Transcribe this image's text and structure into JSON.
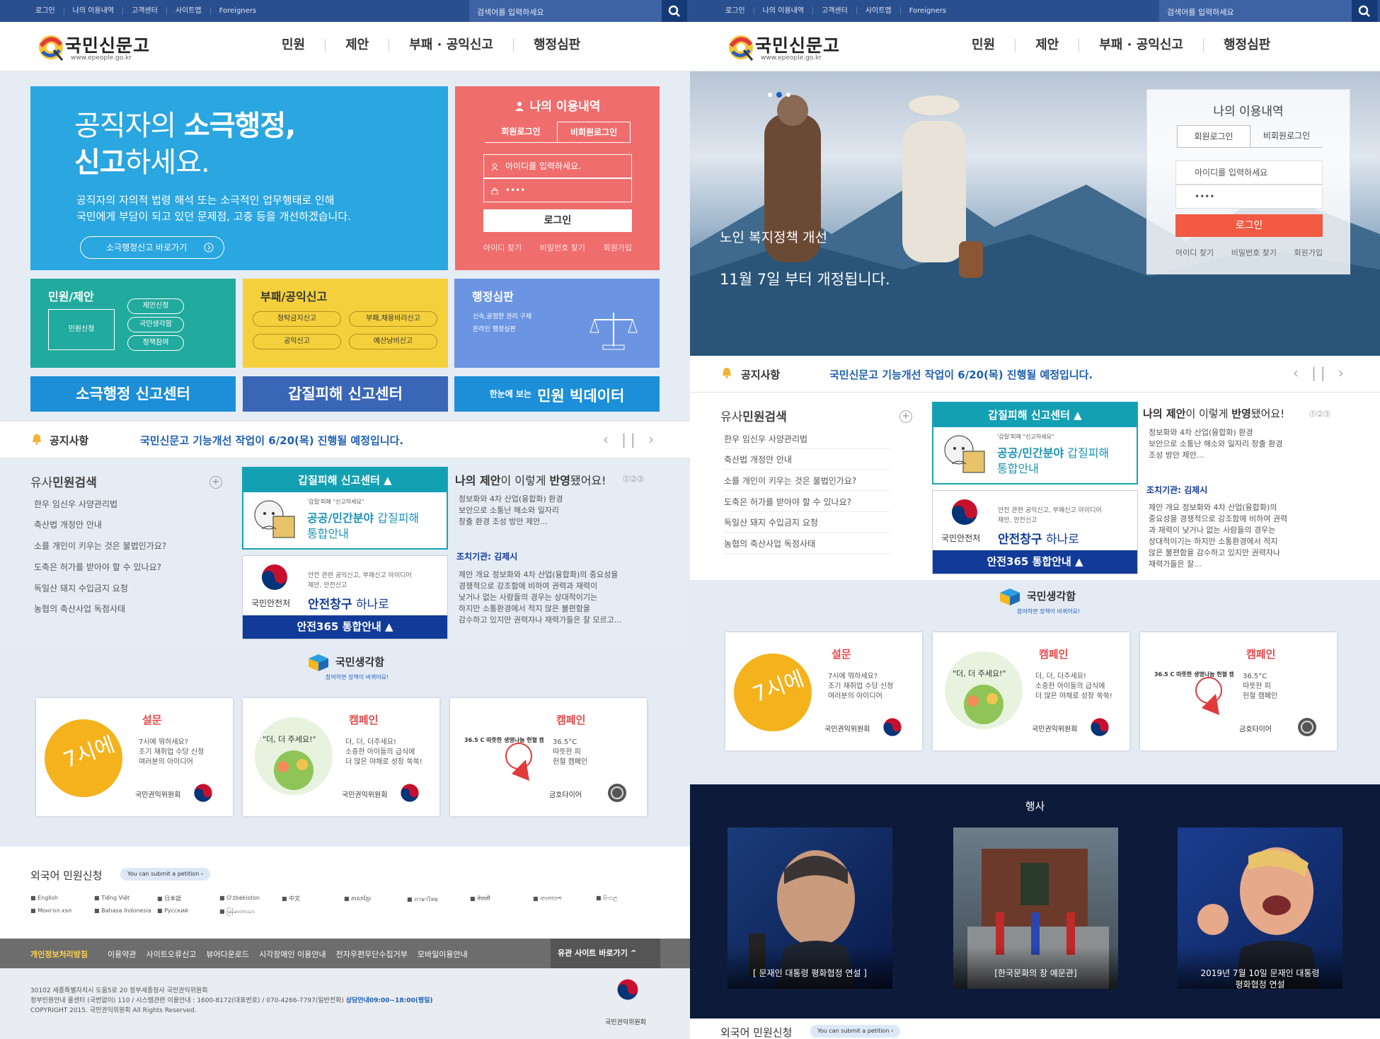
{
  "topbar": {
    "links": [
      "로그인",
      "나의 이용내역",
      "고객센터",
      "사이트맵",
      "Foreigners"
    ],
    "search_placeholder": "검색어를 입력하세요"
  },
  "logo": {
    "title": "국민신문고",
    "url": "www.epeople.go.kr"
  },
  "nav": [
    "민원",
    "제안",
    "부패 · 공익신고",
    "행정심판"
  ],
  "heroA": {
    "title_a": "공직자의 ",
    "title_b": "소극행정,",
    "title_c": "신고",
    "title_d": "하세요.",
    "desc_1": "공직자의 자의적 법령 해석 또는 소극적인 업무행태로 인해",
    "desc_2": "국민에게 부담이 되고 있던 문제점, 고충 등을 개선하겠습니다.",
    "button": "소극행정신고 바로가기"
  },
  "login": {
    "title": "나의 이용내역",
    "tab_member": "회원로그인",
    "tab_nonmember": "비회원로그인",
    "id_placeholder": "아이디를 입력하세요.",
    "pw_value": "••••",
    "button": "로그인",
    "find_id": "아이디 찾기",
    "find_pw": "비밀번호 찾기",
    "join": "회원가입"
  },
  "loginB": {
    "id_placeholder": "아이디를 입력하세요"
  },
  "tiles": {
    "civil": {
      "title": "민원/제안",
      "main": "민원신청",
      "items": [
        "제안신청",
        "국민생각함",
        "정책참여"
      ]
    },
    "corruption": {
      "title": "부패/공익신고",
      "items": [
        "청탁금지신고",
        "부패,채용비리신고",
        "공익신고",
        "예산낭비신고"
      ]
    },
    "trial": {
      "title": "행정심판",
      "desc_1": "신속,공정한 권리 구제",
      "desc_2": "온라인 행정심판"
    }
  },
  "big_buttons": {
    "passive": "소극행정 신고센터",
    "gapjil": "갑질피해 신고센터",
    "bigdata_small": "한눈에 보는",
    "bigdata": "민원 빅데이터"
  },
  "notice": {
    "label": "공지사항",
    "text": "국민신문고 기능개선 작업이 6/20(목) 진행될 예정입니다."
  },
  "similar": {
    "title_a": "유사",
    "title_b": "민원검색",
    "items": [
      "한우 임신우 사양관리법",
      "축산법 개정안 안내",
      "소를 개인이 키우는 것은 불법인가요?",
      "도축은 허가를 받아야 할 수 있나요?",
      "독일산 돼지 수입금지 요청",
      "농협의 축산사업 독점사태"
    ]
  },
  "gapjil": {
    "header": "갑질피해 신고센터",
    "quote": "'갑질'피해 \"신고하세요\"",
    "title_a": "공공/민간분야",
    "title_b": " 갑질피해",
    "title_c": "통합안내"
  },
  "safety": {
    "desc_1": "안전 관련 공익신고, 부패신고 아이디어",
    "desc_2": "제안, 안전신고",
    "agency": "국민안전처",
    "title_a": "안전창구",
    "title_b": " 하나로",
    "footer": "안전365 통합안내"
  },
  "reflect": {
    "title_a": "나의 제안",
    "title_b": "이 이렇게 ",
    "title_c": "반영",
    "title_d": "됐어요!",
    "text_1": "정보화와 4차 산업(융합화) 환경",
    "text_2": "보안으로 소통난 해소와 일자리",
    "text_3": "창출 환경 조성 방안 제안...",
    "agency": "조치기관: 김제시",
    "body_1": "제안 개요 정보화와 4차 산업(융합화)의 중요성을",
    "body_2": "경쟁적으로 강조함에 비하여 권력과 재력이",
    "body_3": "낮거나 없는 사람들의 경우는 상대적이기는",
    "body_4": "하지만 소통환경에서 적지 않은 불편함을",
    "body_5": "감수하고 있지만 권력자나 재력가들은 잘 모르고..."
  },
  "reflectB": {
    "text_1": "정보화와 4차 산업(융합화) 환경",
    "text_2": "보안으로 소통난 해소와 일자리 창출 환경",
    "text_3": "조성 방안 제안...",
    "body_1": "제안 개요 정보화와 4차 산업(융합화)의",
    "body_2": "중요성을 경쟁적으로 강조함에 비하여 권력",
    "body_3": "과 재력이 낮거나 없는 사람들의 경우는",
    "body_4": "상대적이기는 하지만 소통환경에서 적지",
    "body_5": "않은 불편함을 감수하고 있지만 권력자나",
    "body_6": "재력가들은 잘..."
  },
  "idea": {
    "title": "국민생각함",
    "sub": "참여하면 정책이 바뀌어요!"
  },
  "cards": [
    {
      "cat": "설문",
      "d1": "7시에 뭐하세요?",
      "d2": "조기 재취업 수당 신청",
      "d3": "여러분의 아이디어",
      "org": "국민권익위원회",
      "art": "7시에 뭐하세요?"
    },
    {
      "cat": "캠페인",
      "d1": "더, 더, 더주세요!",
      "d2": "소중한 아이들의 급식에",
      "d3": "더 많은 야채로 성장 쑥쑥!",
      "org": "국민권익위원회",
      "art": "\"더, 더 주세요!\""
    },
    {
      "cat": "캠페인",
      "d1": "36.5°C",
      "d2": "따뜻한 피",
      "d3": "헌혈 캠페인",
      "org": "금호타이어",
      "art": "36.5 C 따뜻한 생명나눔 헌혈 캠페인"
    }
  ],
  "foreign": {
    "title": "외국어 민원신청",
    "badge": "You can submit a petition",
    "langs": [
      "English",
      "Tiếng Việt",
      "日本語",
      "O'zbekiston",
      "中文",
      "ភាសាខ្មែរ",
      "ภาษาไทย",
      "नेपाली",
      "বাংলাদেশ",
      "සිංහල",
      "Монгол хэл",
      "Bahasa Indonesia",
      "Русский",
      "မြန်မာဘာသာ"
    ]
  },
  "footer": {
    "privacy": "개인정보처리방침",
    "links": [
      "이용약관",
      "사이트오류신고",
      "뷰어다운로드",
      "시각장애인 이용안내",
      "전자우편무단수집거부",
      "모바일이용안내"
    ],
    "family": "유관 사이트 바로가기",
    "addr": "30102 세종특별자치시 도움5로 20 정부세종청사 국민권익위원회",
    "tel": "정부민원안내 콜센터 (국번없이) 110 / 시스템관련 이용안내 : 1600-8172(대표번호) / 070-4266-7797(일반전화)",
    "hours": "상담안내09:00~18:00(평일)",
    "copy": "COPYRIGHT 2015. 국민권익위원회 All Rights Reserved.",
    "org": "국민권익위원회"
  },
  "heroB": {
    "line1": "노인 복지정책 개선",
    "line2": "11월 7일 부터 개정됩니다."
  },
  "events": {
    "title": "행사",
    "items": [
      {
        "cap1": "[ 문재인 대통령 평화협정 연설 ]",
        "cap2": ""
      },
      {
        "cap1": "[한국문화의 창 예문관]",
        "cap2": ""
      },
      {
        "cap1": "2019년 7월 10일 문재인 대통령",
        "cap2": "평화협정 연설"
      }
    ]
  },
  "colors": {
    "topbar": "#2a4f8f",
    "hero": "#2aa6e0",
    "login": "#f06d6d",
    "civil": "#21aa9e",
    "corruption": "#f4d03d",
    "trial": "#6b95e2",
    "notice_text": "#1d5fb5"
  }
}
